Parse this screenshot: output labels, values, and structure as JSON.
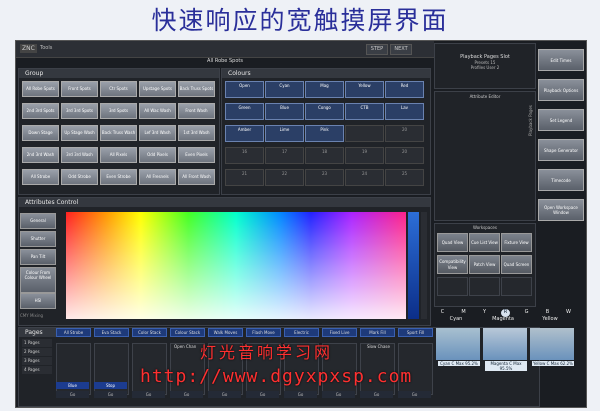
{
  "banner": {
    "title": "快速响应的宽触摸屏界面"
  },
  "topbar": {
    "logo": "ZNC",
    "tools": "Tools",
    "btn1": "STEP",
    "btn2": "NEXT"
  },
  "subtitle": "All Robe Spots",
  "group": {
    "title": "Group",
    "buttons": [
      "All Robe Spots",
      "Front Spots",
      "Ctr Spots",
      "Upstage Spots",
      "Back Truss Spots",
      "2nd 3rd Spots",
      "3rd 3rd Spots",
      "3rd Spots",
      "All Wac Wash",
      "Front Wash",
      "Down Stage Wash",
      "Up Stage Wash",
      "Back Truss Wash",
      "Lef 3rd Wash",
      "1st 3rd Wash",
      "2nd 3rd Wash",
      "3rd 3rd Wash",
      "All Pixels",
      "Odd Pixels",
      "Even Pixels",
      "All Strobe",
      "Odd Strobe",
      "Even Strobe",
      "All Fresnels",
      "All Front Wash"
    ]
  },
  "colours": {
    "title": "Colours",
    "row1": [
      "Open",
      "Cyan",
      "Mag",
      "Yellow",
      "Red"
    ],
    "row2": [
      "Green",
      "Blue",
      "Congo",
      "CTB",
      "Lav"
    ],
    "row3": [
      "Amber",
      "Lime",
      "Pink",
      "",
      "20"
    ],
    "row4": [
      "16",
      "17",
      "18",
      "19",
      "20"
    ],
    "row5": [
      "21",
      "22",
      "23",
      "24",
      "25"
    ]
  },
  "attributes": {
    "title": "Attributes Control",
    "side": [
      "General",
      "Shutter",
      "Pan Tilt",
      "Colour From Colour Wheel",
      "HSI"
    ],
    "cmy_hint": "CMY Mixing"
  },
  "pages": {
    "title": "Pages",
    "items": [
      "1 Pages",
      "2 Pages",
      "3 Pages",
      "4 Pages"
    ],
    "top_buttons": [
      "All Strobe",
      "Eva Stack",
      "Color Stack",
      "Colour Stack",
      "Walk Moves",
      "Flash Move",
      "Electric",
      "Fixed Live",
      "Mark Fill",
      "Sport Fill"
    ],
    "fader_labels": [
      "Open Chan",
      "Slow Chase"
    ],
    "strip_blue": [
      "Blue",
      "Stop"
    ],
    "strip_gray": [
      "Go",
      "Go",
      "Go",
      "Go",
      "Go",
      "Go",
      "Go",
      "Go",
      "Go",
      "Go"
    ]
  },
  "playback": {
    "title": "Playback Pages Slot",
    "line2": "Presets 15",
    "line3": "Profiles User 2",
    "attr_editor": "Attribute Editor",
    "vertical_label": "Playback Pages"
  },
  "right_buttons": [
    "Edit Times",
    "Playback Options",
    "Set Legend",
    "Shape Generator",
    "Timecode",
    "Open Workspace Window"
  ],
  "workspace": {
    "title": "Workspaces",
    "buttons": [
      "Quad View",
      "Cue List View",
      "Fixture View",
      "Compatibility View",
      "Patch View",
      "Quad Screen"
    ]
  },
  "colour_letters": [
    "C",
    "M",
    "Y",
    "R",
    "G",
    "B",
    "W"
  ],
  "cmy": {
    "labels": [
      "Cyan",
      "Magenta",
      "Yellow"
    ],
    "values": [
      "Cyan C Max 95.2%",
      "Magenta C Max 95.5%",
      "Yellow C Max 62.2%"
    ],
    "tints": [
      "#a8c0d0",
      "#b8c8d8",
      "#b0c0cc"
    ]
  },
  "watermark": {
    "line1": "灯光音响学习网",
    "line2": "http://www.dgyxpxsp.com"
  }
}
